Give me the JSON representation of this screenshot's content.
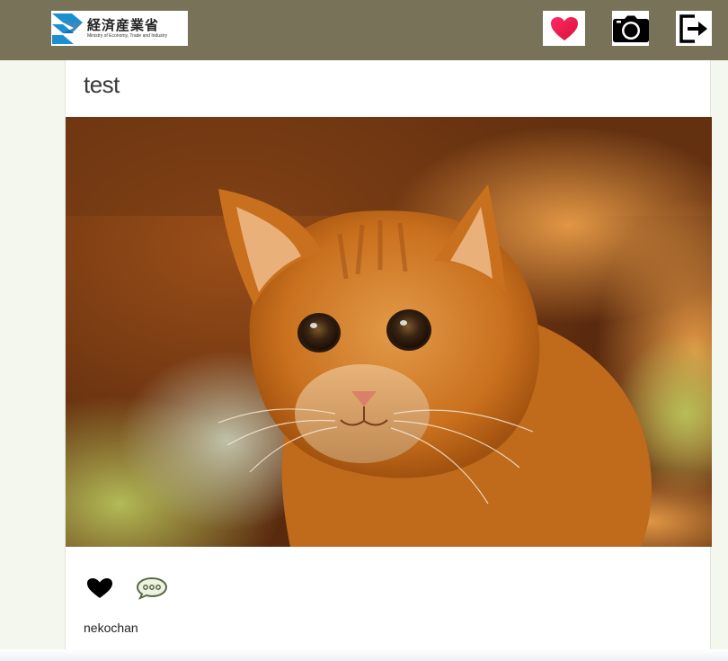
{
  "header": {
    "logo": {
      "jp_text": "経済産業省",
      "en_text": "Ministry of Economy, Trade and Industry"
    },
    "nav": [
      {
        "icon": "heart-icon",
        "color": "#e8194b"
      },
      {
        "icon": "camera-icon",
        "color": "#000000"
      },
      {
        "icon": "logout-icon",
        "color": "#000000"
      }
    ],
    "background": "#787259"
  },
  "post": {
    "title": "test",
    "image": {
      "subject": "orange tabby cat"
    },
    "actions": [
      {
        "icon": "heart-icon",
        "color": "#000000"
      },
      {
        "icon": "speech-bubble-icon",
        "color": "#6b7a52"
      }
    ],
    "author": "nekochan"
  }
}
